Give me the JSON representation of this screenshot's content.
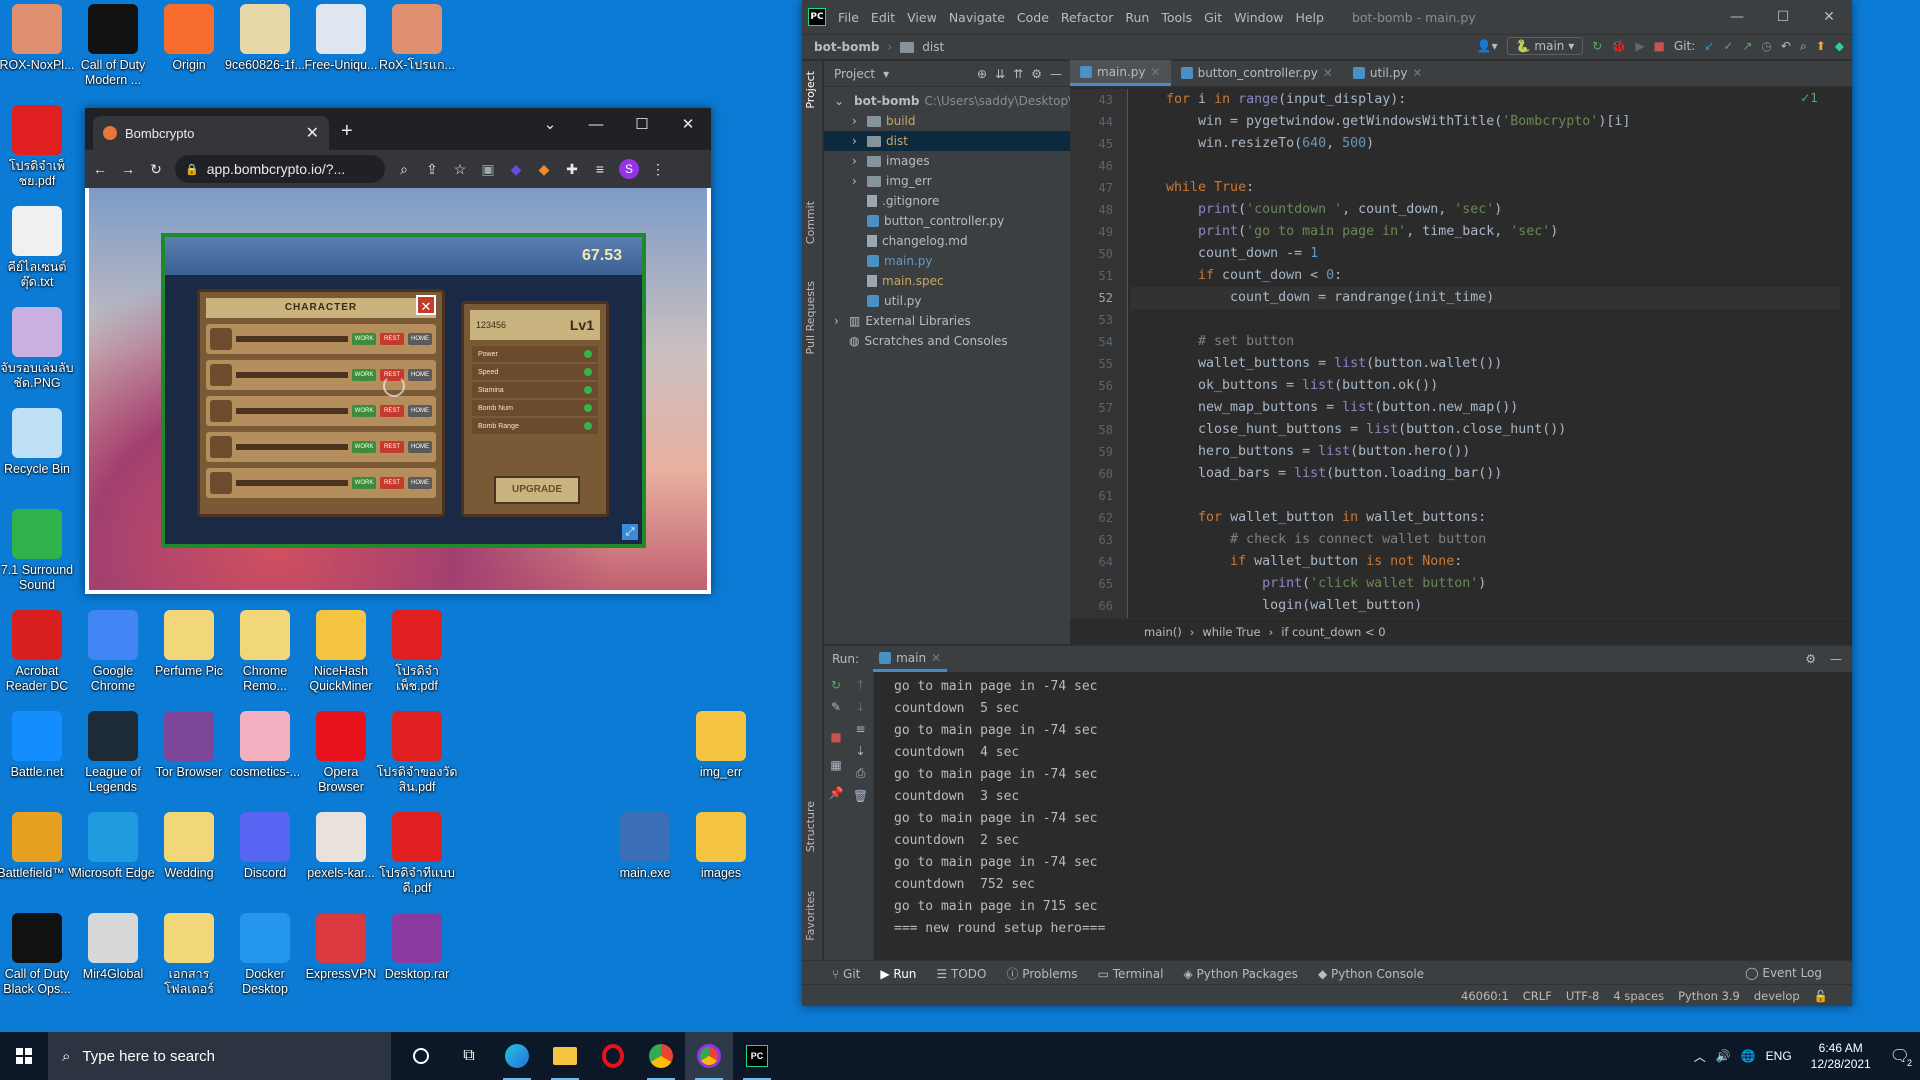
{
  "desktop": {
    "icons": [
      {
        "label": "ROX-NoxPl...",
        "color": "#e09070"
      },
      {
        "label": "Call of Duty Modern ...",
        "color": "#111111"
      },
      {
        "label": "Origin",
        "color": "#f56c2d"
      },
      {
        "label": "9ce60826-1f...",
        "color": "#e8d8a8"
      },
      {
        "label": "Free-Uniqu...",
        "color": "#dfe6f0"
      },
      {
        "label": "RoX-โปรแก...",
        "color": "#e09070"
      },
      {
        "label": "โปรดิจำเพ็ชย.pdf",
        "color": "#e02020"
      },
      {
        "label": "คีย์ไลเซนต์ตุ๊ด.txt",
        "color": "#f0f0f0"
      },
      {
        "label": "จับรอบเล่มลับชัด.PNG",
        "color": "#c8b0e0"
      },
      {
        "label": "Recycle Bin",
        "color": "#bfe0f5"
      },
      {
        "label": "7.1 Surround Sound",
        "color": "#2fb34a"
      },
      {
        "label": "Acrobat Reader DC",
        "color": "#d81e1e"
      },
      {
        "label": "Google Chrome",
        "color": "#4285f4"
      },
      {
        "label": "Perfume Pic",
        "color": "#f2d67a"
      },
      {
        "label": "Chrome Remo...",
        "color": "#f2d67a"
      },
      {
        "label": "NiceHash QuickMiner",
        "color": "#f5c542"
      },
      {
        "label": "โปรดิจำเพ็ช.pdf",
        "color": "#e02020"
      },
      {
        "label": "Battle.net",
        "color": "#148eff"
      },
      {
        "label": "League of Legends",
        "color": "#1c2a3a"
      },
      {
        "label": "Tor Browser",
        "color": "#7d4698"
      },
      {
        "label": "cosmetics-...",
        "color": "#f2b0c0"
      },
      {
        "label": "Opera Browser",
        "color": "#e8121c"
      },
      {
        "label": "โปรดิจำของวัดสิน.pdf",
        "color": "#e02020"
      },
      {
        "label": "img_err",
        "color": "#f5c542"
      },
      {
        "label": "Battlefield™ V",
        "color": "#e8a020"
      },
      {
        "label": "Microsoft Edge",
        "color": "#1f9ce0"
      },
      {
        "label": "Wedding",
        "color": "#f2d67a"
      },
      {
        "label": "Discord",
        "color": "#5865f2"
      },
      {
        "label": "pexels-kar...",
        "color": "#e8e2da"
      },
      {
        "label": "โปรดิจำทีแบบดี.pdf",
        "color": "#e02020"
      },
      {
        "label": "main.exe",
        "color": "#3a6fb5"
      },
      {
        "label": "images",
        "color": "#f5c542"
      },
      {
        "label": "Call of Duty Black Ops...",
        "color": "#111111"
      },
      {
        "label": "Mir4Global",
        "color": "#d8d8d8"
      },
      {
        "label": "เอกสารโฟลเดอร์",
        "color": "#f2d67a"
      },
      {
        "label": "Docker Desktop",
        "color": "#2496ed"
      },
      {
        "label": "ExpressVPN",
        "color": "#da3940"
      },
      {
        "label": "Desktop.rar",
        "color": "#8a3aa0"
      }
    ]
  },
  "chrome": {
    "tab_title": "Bombcrypto",
    "url": "app.bombcrypto.io/?...",
    "profile_initial": "S",
    "game": {
      "coins": "67.53",
      "panel_title": "CHARACTER",
      "stats_id": "123456",
      "stats_level": "Lv1",
      "stats": [
        "Power",
        "Speed",
        "Stamina",
        "Bomb Num",
        "Bomb Range"
      ],
      "upgrade_label": "UPGRADE",
      "hero_buttons": [
        "WORK",
        "REST",
        "HOME"
      ],
      "hero_count": 5
    }
  },
  "pycharm": {
    "menu": [
      "File",
      "Edit",
      "View",
      "Navigate",
      "Code",
      "Refactor",
      "Run",
      "Tools",
      "Git",
      "Window",
      "Help"
    ],
    "window_title": "bot-bomb - main.py",
    "nav_project": "bot-bomb",
    "nav_folder": "dist",
    "branch": "main",
    "git_label": "Git:",
    "project_header": "Project",
    "tree": [
      {
        "label": "bot-bomb",
        "hint": "C:\\Users\\saddy\\Desktop\\t",
        "depth": 0,
        "kind": "folder",
        "open": true
      },
      {
        "label": "build",
        "depth": 1,
        "kind": "folder",
        "color": "#c8a860"
      },
      {
        "label": "dist",
        "depth": 1,
        "kind": "folder",
        "sel": true,
        "color": "#c8a860"
      },
      {
        "label": "images",
        "depth": 1,
        "kind": "folder"
      },
      {
        "label": "img_err",
        "depth": 1,
        "kind": "folder"
      },
      {
        "label": ".gitignore",
        "depth": 1,
        "kind": "file"
      },
      {
        "label": "button_controller.py",
        "depth": 1,
        "kind": "py"
      },
      {
        "label": "changelog.md",
        "depth": 1,
        "kind": "file"
      },
      {
        "label": "main.py",
        "depth": 1,
        "kind": "py",
        "color": "#6897bb"
      },
      {
        "label": "main.spec",
        "depth": 1,
        "kind": "file",
        "color": "#c8a860"
      },
      {
        "label": "util.py",
        "depth": 1,
        "kind": "py"
      },
      {
        "label": "External Libraries",
        "depth": 0,
        "kind": "lib"
      },
      {
        "label": "Scratches and Consoles",
        "depth": 0,
        "kind": "scratch"
      }
    ],
    "editor_tabs": [
      {
        "label": "main.py",
        "active": true
      },
      {
        "label": "button_controller.py",
        "active": false
      },
      {
        "label": "util.py",
        "active": false
      }
    ],
    "inspection": "✓1",
    "line_numbers": [
      "43",
      "44",
      "45",
      "46",
      "47",
      "48",
      "49",
      "50",
      "51",
      "52",
      "53",
      "54",
      "55",
      "56",
      "57",
      "58",
      "59",
      "60",
      "61",
      "62",
      "63",
      "64",
      "65",
      "66"
    ],
    "code_lines": [
      "<span class='k'>for</span> i <span class='k'>in</span> <span class='b'>range</span>(input_display):",
      "    win = pygetwindow.getWindowsWithTitle(<span class='s'>'Bombcrypto'</span>)[i]",
      "    win.resizeTo(<span class='n'>640</span>, <span class='n'>500</span>)",
      "",
      "<span class='k'>while</span> <span class='k'>True</span>:",
      "    <span class='b'>print</span>(<span class='s'>'countdown '</span>, count_down, <span class='s'>'sec'</span>)",
      "    <span class='b'>print</span>(<span class='s'>'go to main page in'</span>, time_back, <span class='s'>'sec'</span>)",
      "    count_down -= <span class='n'>1</span>",
      "    <span class='k'>if</span> count_down &lt; <span class='n'>0</span>:",
      "        count_down = randrange(init_time)",
      "",
      "    <span class='c'># set button</span>",
      "    wallet_buttons = <span class='b'>list</span>(button.wallet())",
      "    ok_buttons = <span class='b'>list</span>(button.ok())",
      "    new_map_buttons = <span class='b'>list</span>(button.new_map())",
      "    close_hunt_buttons = <span class='b'>list</span>(button.close_hunt())",
      "    hero_buttons = <span class='b'>list</span>(button.hero())",
      "    load_bars = <span class='b'>list</span>(button.loading_bar())",
      "",
      "    <span class='k'>for</span> wallet_button <span class='k'>in</span> wallet_buttons:",
      "        <span class='c'># check is connect wallet button</span>",
      "        <span class='k'>if</span> wallet_button <span class='k'>is not</span> <span class='k'>None</span>:",
      "            <span class='b'>print</span>(<span class='s'>'click wallet button'</span>)",
      "            login(wallet_button)"
    ],
    "current_line_index": 9,
    "breadcrumb": [
      "main()",
      "while True",
      "if count_down < 0"
    ],
    "run_label": "Run:",
    "run_tab": "main",
    "output": [
      "go to main page in -74 sec",
      "countdown  5 sec",
      "go to main page in -74 sec",
      "countdown  4 sec",
      "go to main page in -74 sec",
      "countdown  3 sec",
      "go to main page in -74 sec",
      "countdown  2 sec",
      "go to main page in -74 sec",
      "countdown  752 sec",
      "go to main page in 715 sec",
      "=== new round setup hero==="
    ],
    "bottom_tabs": [
      "Git",
      "Run",
      "TODO",
      "Problems",
      "Terminal",
      "Python Packages",
      "Python Console"
    ],
    "event_log": "Event Log",
    "status": [
      "46060:1",
      "CRLF",
      "UTF-8",
      "4 spaces",
      "Python 3.9",
      "develop"
    ],
    "side_tabs": [
      "Project",
      "Commit",
      "Pull Requests",
      "Structure",
      "Favorites"
    ]
  },
  "taskbar": {
    "search_placeholder": "Type here to search",
    "lang": "ENG",
    "time": "6:46 AM",
    "date": "12/28/2021",
    "notifications": "2"
  }
}
